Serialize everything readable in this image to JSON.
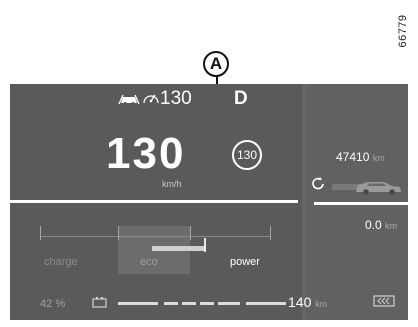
{
  "figure_ref": "66779",
  "callout": "A",
  "cluster": {
    "cruise_speed": "130",
    "gear": "D",
    "speed": "130",
    "speed_unit": "km/h",
    "speed_limit": "130",
    "odometer": {
      "value": "47410",
      "unit": "km"
    },
    "trip": {
      "value": "0.0",
      "unit": "km"
    },
    "power_gauge": {
      "labels": {
        "charge": "charge",
        "eco": "eco",
        "power": "power"
      },
      "level": 0.45
    },
    "battery": {
      "percent": "42",
      "unit": "%"
    },
    "range": {
      "value": "140",
      "unit": "km"
    }
  },
  "icons": {
    "driver_assist": "car-driver-assist-icon",
    "speed_assist": "speedometer-assist-icon",
    "vehicle": "vehicle-side-icon",
    "battery": "battery-plug-icon",
    "regen": "regenerative-braking-icon"
  },
  "colors": {
    "panel": "#5a5a5a",
    "text": "#ffffff",
    "dim": "#a0a0a0"
  }
}
